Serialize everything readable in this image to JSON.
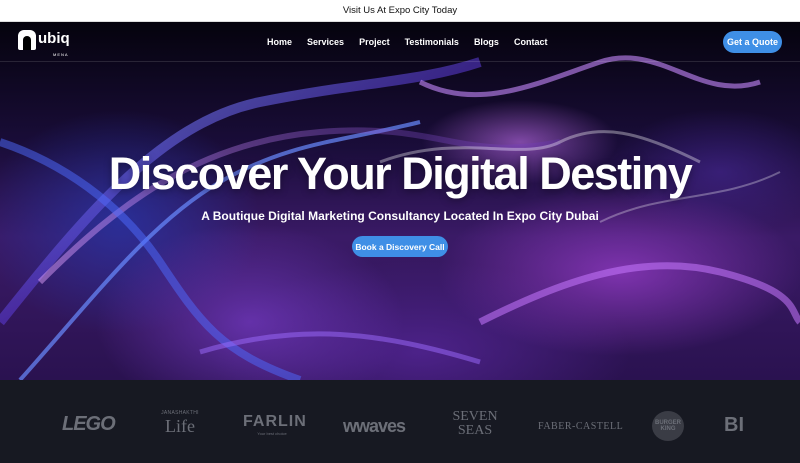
{
  "announcement": {
    "text": "Visit Us At Expo City Today"
  },
  "nav": {
    "logo_text": "ubiq",
    "logo_sub": "MENA",
    "items": [
      {
        "label": "Home"
      },
      {
        "label": "Services"
      },
      {
        "label": "Project"
      },
      {
        "label": "Testimonials"
      },
      {
        "label": "Blogs"
      },
      {
        "label": "Contact"
      }
    ],
    "quote_button": "Get a Quote"
  },
  "hero": {
    "headline": "Discover Your Digital Destiny",
    "subheadline": "A Boutique Digital Marketing Consultancy Located In Expo City Dubai",
    "cta_label": "Book a Discovery Call"
  },
  "client_logos": {
    "lego": "LEGO",
    "janashakthi_top": "JANASHAKTHI",
    "janashakthi_bottom": "Life",
    "farlin": "FARLIN",
    "farlin_tag": "Your best choice",
    "waves": "wwaves",
    "seven_seas_top": "SEVEN",
    "seven_seas_bottom": "SEAS",
    "faber_castell": "FABER-CASTELL",
    "burger_king_top": "BURGER",
    "burger_king_bottom": "KING",
    "partial": "BI"
  },
  "colors": {
    "accent": "#3f8fe6",
    "announce_bg": "#ffffff",
    "logo_strip_bg": "#171922",
    "logo_gray": "#6c6f78"
  }
}
